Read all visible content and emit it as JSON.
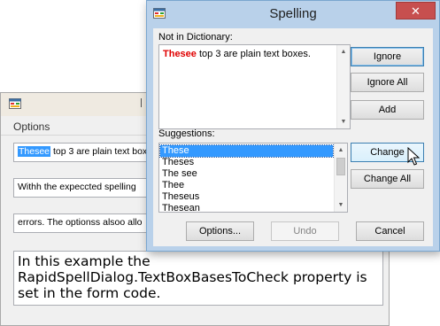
{
  "main_window": {
    "menu_label": "Options",
    "textbox1": {
      "highlighted": "Thesee",
      "rest": " top 3 are plain text box"
    },
    "textbox2": "Withh the expeccted spelling",
    "textbox3": "errors.  The optionss alsoo allo",
    "rich_text": "In this example the RapidSpellDialog.TextBoxBasesToCheck property is set in the form code."
  },
  "dialog": {
    "title": "Spelling",
    "close_label": "✕",
    "not_in_dictionary_label": "Not in Dictionary:",
    "misspelled_word": "Thesee",
    "context_text": " top 3 are plain text boxes.",
    "suggestions_label": "Suggestions:",
    "suggestions": [
      "These",
      "Theses",
      "The see",
      "Thee",
      "Theseus",
      "Thesean"
    ],
    "selected_suggestion_index": 0,
    "buttons": {
      "ignore": "Ignore",
      "ignore_all": "Ignore All",
      "add": "Add",
      "change": "Change",
      "change_all": "Change All",
      "options": "Options...",
      "undo": "Undo",
      "cancel": "Cancel"
    }
  },
  "colors": {
    "error_text": "#e00000",
    "selection": "#3399ff",
    "dialog_frame": "#b9d1ea",
    "close_button": "#c74f4f"
  },
  "icons": [
    "app-icon",
    "close-icon",
    "scroll-up-arrow-icon",
    "scroll-down-arrow-icon",
    "mouse-cursor-icon"
  ]
}
